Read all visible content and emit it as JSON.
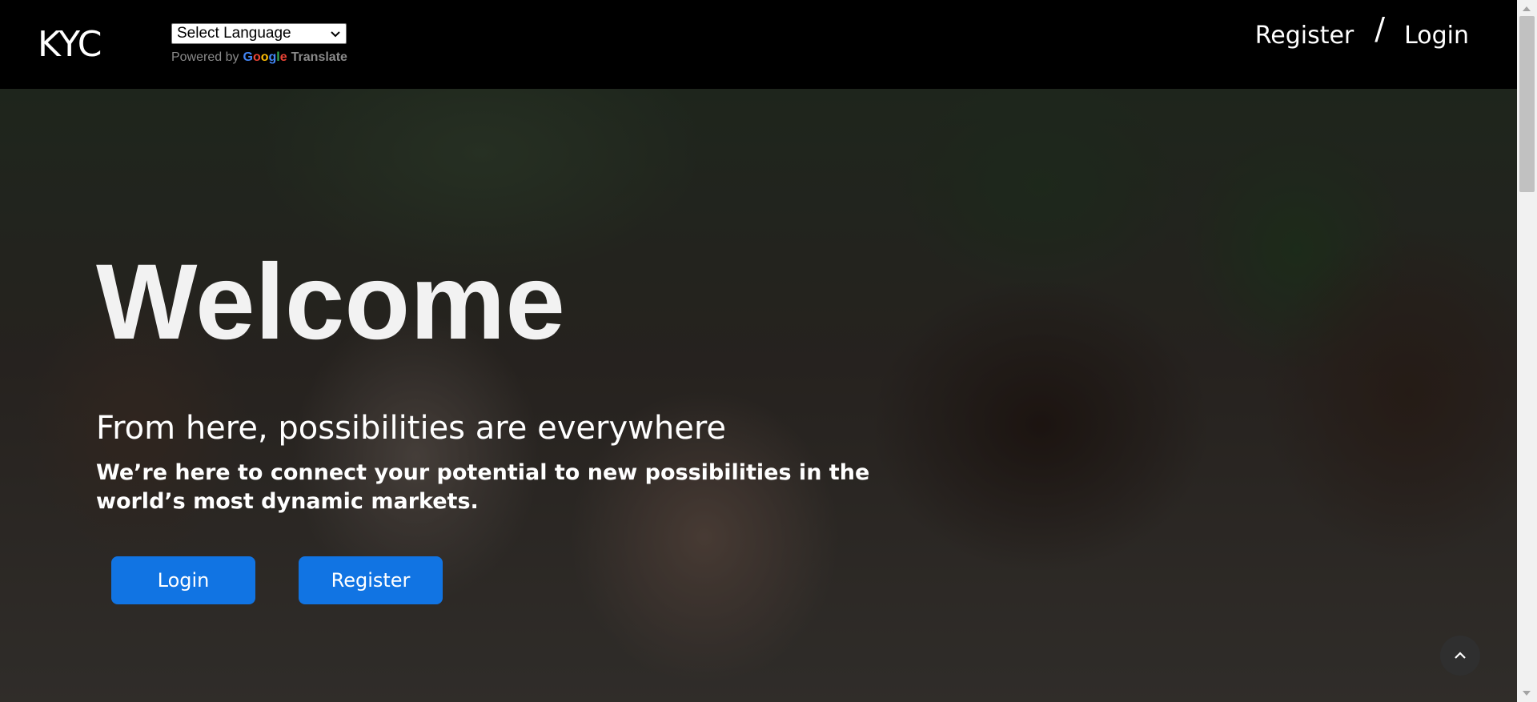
{
  "header": {
    "logo": "KYC",
    "language_select": {
      "selected": "Select Language"
    },
    "powered_by": "Powered by",
    "google_letters": [
      "G",
      "o",
      "o",
      "g",
      "l",
      "e"
    ],
    "translate_label": "Translate",
    "nav": {
      "register": "Register",
      "separator": "/",
      "login": "Login"
    }
  },
  "hero": {
    "title": "Welcome",
    "subtitle": "From here, possibilities are everywhere",
    "description": "We’re here to connect your potential to new possibilities in the world’s most dynamic markets.",
    "buttons": {
      "login": "Login",
      "register": "Register"
    }
  },
  "icons": {
    "back_to_top": "chevron-up-icon",
    "select_arrow": "chevron-down-icon"
  },
  "colors": {
    "button_blue": "#1174e3",
    "header_bg": "#000000",
    "back_to_top_bg": "#2f2f2f"
  }
}
